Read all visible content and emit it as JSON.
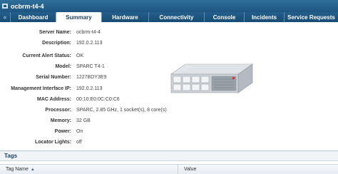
{
  "window": {
    "title": "ocbrm-t4-4"
  },
  "tabs": [
    {
      "label": "Dashboard"
    },
    {
      "label": "Summary"
    },
    {
      "label": "Hardware"
    },
    {
      "label": "Connectivity"
    },
    {
      "label": "Console"
    },
    {
      "label": "Incidents"
    },
    {
      "label": "Service Requests"
    }
  ],
  "active_tab": "Summary",
  "summary": {
    "server_name": {
      "label": "Server Name:",
      "value": "ocbrm-t4-4"
    },
    "description": {
      "label": "Description:",
      "value": "192.0.2.113"
    },
    "alert_status": {
      "label": "Current Alert Status:",
      "value": "OK"
    },
    "model": {
      "label": "Model:",
      "value": "SPARC T4-1"
    },
    "serial": {
      "label": "Serial Number:",
      "value": "1227BDY3E9"
    },
    "mgmt_ip": {
      "label": "Management Interface IP:",
      "value": "192.0.2.113"
    },
    "mac": {
      "label": "MAC Address:",
      "value": "00:10:E0:0C:C0:C6"
    },
    "processor": {
      "label": "Processor:",
      "value": "SPARC, 2.85 GHz, 1 socket(s), 8 core(s)"
    },
    "memory": {
      "label": "Memory:",
      "value": "32 GB"
    },
    "power": {
      "label": "Power:",
      "value": "On"
    },
    "locator": {
      "label": "Locator Lights:",
      "value": "off"
    }
  },
  "tags": {
    "title": "Tags",
    "columns": [
      {
        "label": "Tag Name"
      },
      {
        "label": "Value"
      }
    ]
  },
  "colors": {
    "titlebar": "#1d5580",
    "accent": "#245f8c"
  },
  "icons": [
    "collapse-icon",
    "server-icon",
    "sort-ascending-icon"
  ]
}
